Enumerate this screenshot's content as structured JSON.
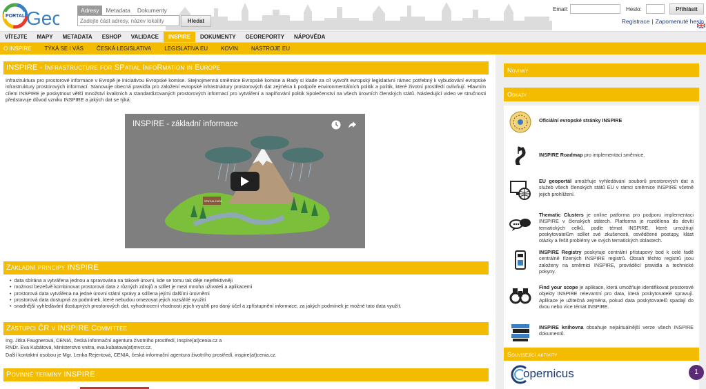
{
  "header": {
    "logo_text": "PORTAL",
    "logo_word": "Geo",
    "search_tabs": [
      {
        "label": "Adresy",
        "active": true
      },
      {
        "label": "Metadata",
        "active": false
      },
      {
        "label": "Dokumenty",
        "active": false
      }
    ],
    "search_placeholder": "Zadejte část adresy, název lokality",
    "search_button": "Hledat",
    "email_label": "Email:",
    "password_label": "Heslo:",
    "login_button": "Přihlásit",
    "register_link": "Registrace",
    "forgot_link": "Zapomenuté heslo"
  },
  "main_nav": [
    {
      "label": "Vítejte",
      "active": false
    },
    {
      "label": "Mapy",
      "active": false
    },
    {
      "label": "Metadata",
      "active": false
    },
    {
      "label": "Eshop",
      "active": false
    },
    {
      "label": "Validace",
      "active": false
    },
    {
      "label": "Inspire",
      "active": true
    },
    {
      "label": "Dokumenty",
      "active": false
    },
    {
      "label": "Georeporty",
      "active": false
    },
    {
      "label": "Nápověda",
      "active": false
    }
  ],
  "sub_nav": [
    {
      "label": "O INSPIRE",
      "active": true
    },
    {
      "label": "Týká se i vás",
      "active": false
    },
    {
      "label": "Česká legislativa",
      "active": false
    },
    {
      "label": "Legislativa EU",
      "active": false
    },
    {
      "label": "KOVIN",
      "active": false
    },
    {
      "label": "Nástroje EU",
      "active": false
    }
  ],
  "intro": {
    "title": "INSPIRE - Infrastructure for SPatial InfoRmation in Europe",
    "text": "Infrastruktura pro prostorové informace v Evropě je iniciativou Evropské komise. Stejnojmenná směrnice Evropské komise a Rady si klade za cíl vytvořit evropský legislativní rámec potřebný k vybudování evropské infrastruktury prostorových informací. Stanovuje obecná pravidla pro založení evropské infrastruktury prostorových dat zejména k podpoře environmentálních politik a politik, které životní prostředí ovlivňují. Hlavním cílem INSPIRE je poskytnout větší množství kvalitních a standardizovaných prostorových informací pro vytváření a naplňování politik Společenství na všech úrovních členských států. Následující video ve stručnosti představuje důvod vzniku INSPIRE a jakých dat se týká:"
  },
  "video": {
    "title": "INSPIRE - základní informace",
    "sign_text": "SPATIAL DATA"
  },
  "principles": {
    "title": "Základní principy INSPIRE",
    "items": [
      "data sbírána a vytvářena jednou a spravována na takové úrovni, kde se tomu tak děje nejefektivněji",
      "možnost bezešvě kombinovat prostorová data z různých zdrojů a sdílet je mezi mnoha uživateli a aplikacemi",
      "prostorová data vytvářena na jedné úrovni státní správy a sdílena jejími dalšími úrovněmi",
      "prostorová data dostupná za podmínek, které nebudou omezovat jejich rozsáhlé využití",
      "snadnější vyhledávání dostupných prostorových dat, vyhodnocení vhodnosti jejich využití pro daný účel a zpřístupnění informace, za jakých podmínek je možné tato data využít."
    ]
  },
  "committee": {
    "title": "Zástupci ČR v INSPIRE Committee",
    "lines": [
      "Ing. Jitka Faugnerová, CENIA, česká informační agentura životního prostředí, inspire(at)cenia.cz a",
      "RNDr. Eva Kubátová, Ministerstvo vnitra, eva.kubatova(at)mvcr.cz.",
      "Další kontaktní osobou je Mgr. Lenka Rejentová, CENIA, česká informační agentura životního prostředí, inspire(at)cenia.cz."
    ]
  },
  "deadlines": {
    "title": "Povinné termíny INSPIRE"
  },
  "sidebar": {
    "news_title": "Novinky",
    "links_title": "Odkazy",
    "links": [
      {
        "bold": "Oficiální evropské stránky INSPIRE",
        "rest": ""
      },
      {
        "bold": "INSPIRE Roadmap",
        "rest": " pro implementaci směrnice."
      },
      {
        "bold": "EU geoportál",
        "rest": " umožňuje vyhledávání souborů prostorových dat a služeb všech členských států EU v rámci směrnice INSPIRE včetně jejich prohlížení."
      },
      {
        "bold": "Thematic Clusters",
        "rest": " je online patforma pro podporu implementaci INSPIRE v členských státech. Platforma je rozdělena do devíti tematických celků, podle témat INSPIRE, které umožňují poskytovatelům sdílet své zkušenosti, osvědčené postupy, klást otázky a řešit problémy ve svých tematických oblastech."
      },
      {
        "bold": "INSPIRE Registry",
        "rest": " poskytuje centrální přístupový bod k celé řadě centrálně řízených INSPIRE registrů. Obsah těchto registrů jsou založeny na směrnici INSPIRE, prováděcí pravidla a technické pokyny."
      },
      {
        "bold": "Find your scope",
        "rest": " je aplikace, která umožňuje identifikovat prostorové objekty INSPIRE relevantní pro data, která poskytovatelé spravují. Aplikace je užitečná zejména, pokud data poskytovatelů spadají do dvou nebo více témat INSPIRE."
      },
      {
        "bold": "INSPIRE knihovna",
        "rest": " obsahuje nejaktuálnější verze všech INSPIRE dokumentů."
      }
    ],
    "related_title": "Související aktivity",
    "copernicus": "opernicus"
  },
  "chat_badge": "1",
  "colors": {
    "accent": "#f3bc00",
    "link": "#1a3f84",
    "badge": "#5a2c73"
  }
}
